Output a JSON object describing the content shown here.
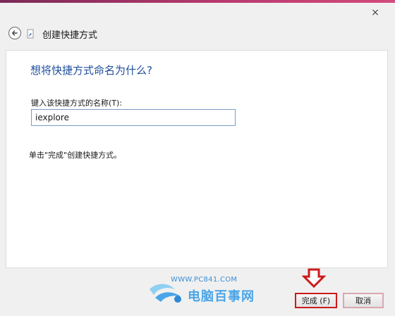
{
  "window": {
    "title": "创建快捷方式",
    "close_glyph": "×"
  },
  "content": {
    "question": "想将快捷方式命名为什么?",
    "field_label": "键入该快捷方式的名称(T):",
    "field_value": "iexplore",
    "hint": "单击\"完成\"创建快捷方式。"
  },
  "buttons": {
    "finish": "完成 (F)",
    "cancel": "取消"
  },
  "watermark": {
    "url": "WWW.PC841.COM",
    "text": "电脑百事网"
  },
  "colors": {
    "question": "#1e4e9c",
    "highlight": "#cc1a1a",
    "watermark": "#4aa5e8"
  }
}
